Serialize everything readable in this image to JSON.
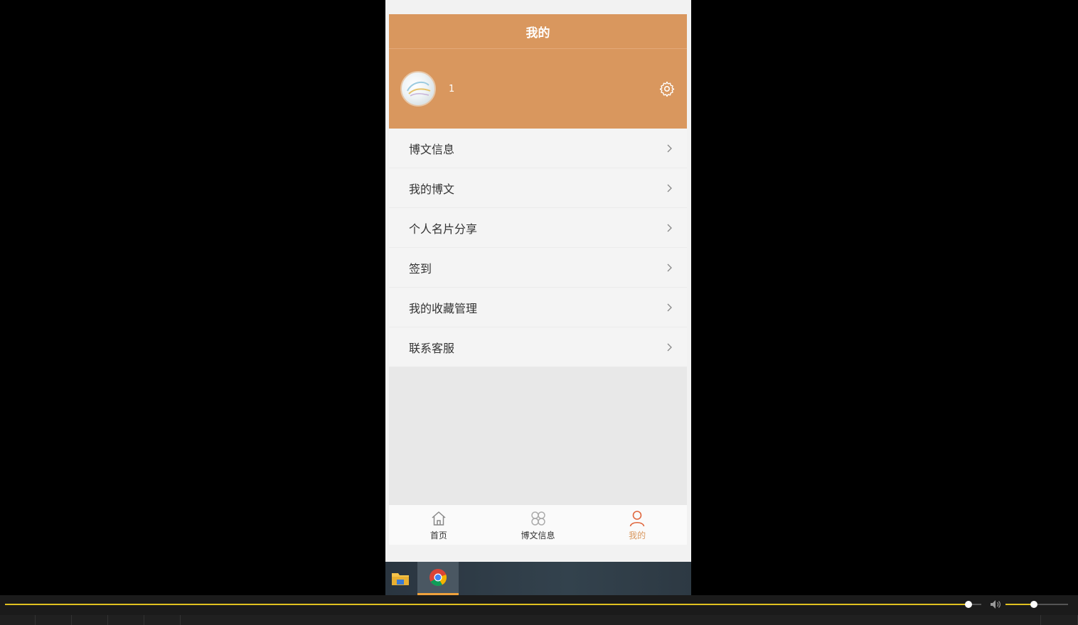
{
  "header": {
    "title": "我的"
  },
  "profile": {
    "username": "1",
    "avatar_icon": "avatar-image",
    "settings_icon": "gear-icon"
  },
  "menu": {
    "items": [
      {
        "label": "博文信息"
      },
      {
        "label": "我的博文"
      },
      {
        "label": "个人名片分享"
      },
      {
        "label": "签到"
      },
      {
        "label": "我的收藏管理"
      },
      {
        "label": "联系客服"
      }
    ]
  },
  "tabbar": {
    "items": [
      {
        "label": "首页",
        "icon": "home-icon",
        "active": false
      },
      {
        "label": "博文信息",
        "icon": "grid-icon",
        "active": false
      },
      {
        "label": "我的",
        "icon": "user-icon",
        "active": true
      }
    ]
  },
  "taskbar": {
    "apps": [
      {
        "icon": "file-explorer-icon"
      },
      {
        "icon": "chrome-icon",
        "active": true
      }
    ]
  },
  "player": {
    "progress": 0.987,
    "volume": 0.45
  },
  "colors": {
    "accent": "#d9975e",
    "active_tab": "#d9975e",
    "seek": "#e0c020"
  }
}
